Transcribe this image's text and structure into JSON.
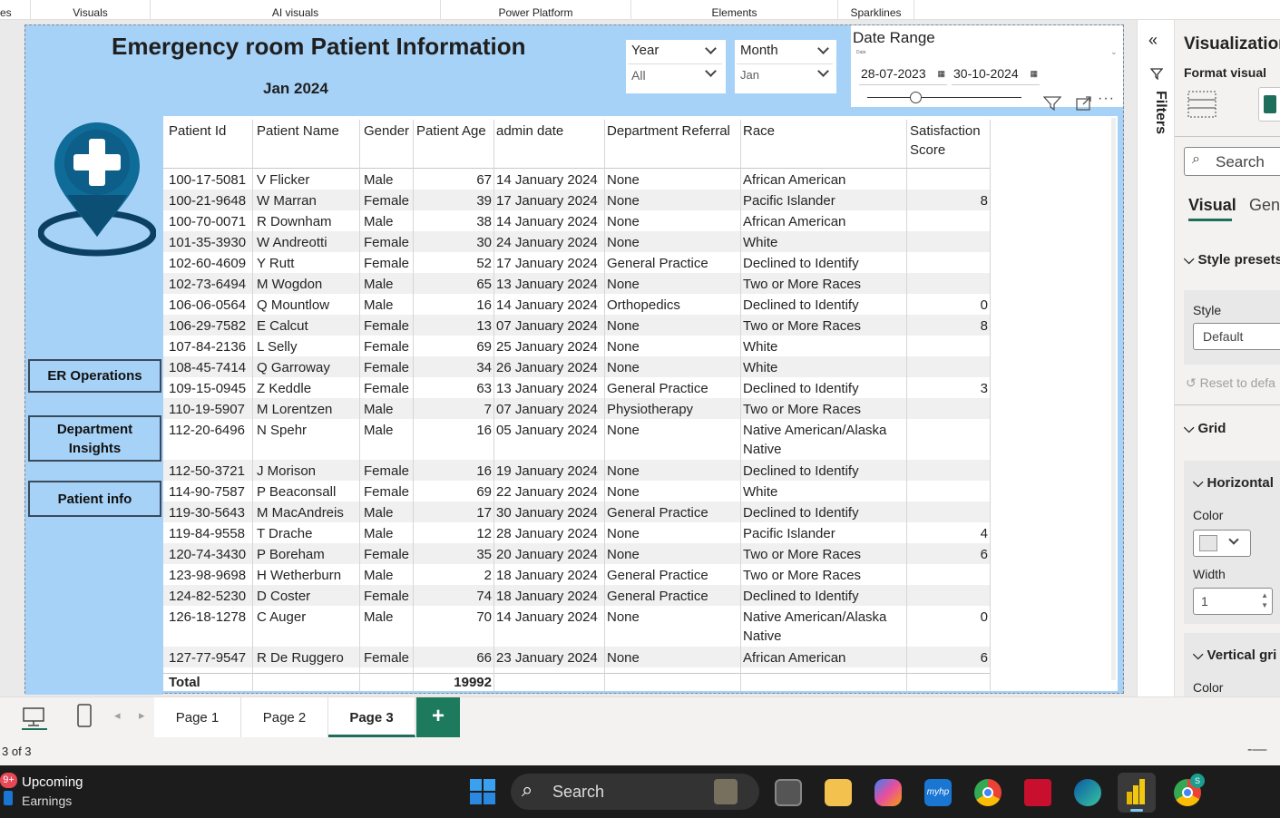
{
  "ribbon": {
    "groups": [
      "es",
      "Visuals",
      "AI visuals",
      "Power Platform",
      "Elements",
      "Sparklines"
    ]
  },
  "report": {
    "title": "Emergency room Patient Information",
    "subtitle": "Jan 2024",
    "year_slicer": {
      "label": "Year",
      "value": "All"
    },
    "month_slicer": {
      "label": "Month",
      "value": "Jan"
    },
    "date_range": {
      "label": "Date Range",
      "small_label": "Date",
      "start": "28-07-2023",
      "end": "30-10-2024"
    },
    "nav_buttons": [
      "ER Operations",
      "Department Insights",
      "Patient info"
    ],
    "table": {
      "headers": [
        "Patient Id",
        "Patient Name",
        "Gender",
        "Patient Age",
        "admin date",
        "Department Referral",
        "Race",
        "Satisfaction Score"
      ],
      "rows": [
        [
          "100-17-5081",
          "V Flicker",
          "Male",
          "67",
          "14 January 2024",
          "None",
          "African American",
          ""
        ],
        [
          "100-21-9648",
          "W Marran",
          "Female",
          "39",
          "17 January 2024",
          "None",
          "Pacific Islander",
          "8"
        ],
        [
          "100-70-0071",
          "R Downham",
          "Male",
          "38",
          "14 January 2024",
          "None",
          "African American",
          ""
        ],
        [
          "101-35-3930",
          "W Andreotti",
          "Female",
          "30",
          "24 January 2024",
          "None",
          "White",
          ""
        ],
        [
          "102-60-4609",
          "Y Rutt",
          "Female",
          "52",
          "17 January 2024",
          "General Practice",
          "Declined to Identify",
          ""
        ],
        [
          "102-73-6494",
          "M Wogdon",
          "Male",
          "65",
          "13 January 2024",
          "None",
          "Two or More Races",
          ""
        ],
        [
          "106-06-0564",
          "Q Mountlow",
          "Male",
          "16",
          "14 January 2024",
          "Orthopedics",
          "Declined to Identify",
          "0"
        ],
        [
          "106-29-7582",
          "E Calcut",
          "Female",
          "13",
          "07 January 2024",
          "None",
          "Two or More Races",
          "8"
        ],
        [
          "107-84-2136",
          "L Selly",
          "Female",
          "69",
          "25 January 2024",
          "None",
          "White",
          ""
        ],
        [
          "108-45-7414",
          "Q Garroway",
          "Female",
          "34",
          "26 January 2024",
          "None",
          "White",
          ""
        ],
        [
          "109-15-0945",
          "Z Keddle",
          "Female",
          "63",
          "13 January 2024",
          "General Practice",
          "Declined to Identify",
          "3"
        ],
        [
          "110-19-5907",
          "M Lorentzen",
          "Male",
          "7",
          "07 January 2024",
          "Physiotherapy",
          "Two or More Races",
          ""
        ],
        [
          "112-20-6496",
          "N Spehr",
          "Male",
          "16",
          "05 January 2024",
          "None",
          "Native American/Alaska Native",
          ""
        ],
        [
          "112-50-3721",
          "J Morison",
          "Female",
          "16",
          "19 January 2024",
          "None",
          "Declined to Identify",
          ""
        ],
        [
          "114-90-7587",
          "P Beaconsall",
          "Female",
          "69",
          "22 January 2024",
          "None",
          "White",
          ""
        ],
        [
          "119-30-5643",
          "M MacAndreis",
          "Male",
          "17",
          "30 January 2024",
          "General Practice",
          "Declined to Identify",
          ""
        ],
        [
          "119-84-9558",
          "T Drache",
          "Male",
          "12",
          "28 January 2024",
          "None",
          "Pacific Islander",
          "4"
        ],
        [
          "120-74-3430",
          "P Boreham",
          "Female",
          "35",
          "20 January 2024",
          "None",
          "Two or More Races",
          "6"
        ],
        [
          "123-98-9698",
          "H Wetherburn",
          "Male",
          "2",
          "18 January 2024",
          "General Practice",
          "Two or More Races",
          ""
        ],
        [
          "124-82-5230",
          "D Coster",
          "Female",
          "74",
          "18 January 2024",
          "General Practice",
          "Declined to Identify",
          ""
        ],
        [
          "126-18-1278",
          "C Auger",
          "Male",
          "70",
          "14 January 2024",
          "None",
          "Native American/Alaska Native",
          "0"
        ],
        [
          "127-77-9547",
          "R De Ruggero",
          "Female",
          "66",
          "23 January 2024",
          "None",
          "African American",
          "6"
        ]
      ],
      "total_label": "Total",
      "total_age": "19992"
    }
  },
  "filters_label": "Filters",
  "viz_panel": {
    "title": "Visualization",
    "format_visual": "Format visual",
    "search_placeholder": "Search",
    "tab_visual": "Visual",
    "tab_general": "Gene",
    "style_presets": "Style presets",
    "style_label": "Style",
    "style_value": "Default",
    "reset": "Reset to defa",
    "grid": "Grid",
    "horizontal": "Horizontal",
    "color_label": "Color",
    "width_label": "Width",
    "width_value": "1",
    "vertical": "Vertical gri",
    "color_label2": "Color",
    "h_color": "#e6e6e6",
    "v_color": "#555555"
  },
  "pages": {
    "tabs": [
      "Page 1",
      "Page 2",
      "Page 3"
    ],
    "active": "Page 3",
    "add": "+"
  },
  "status": {
    "page_of": "3 of 3"
  },
  "taskbar": {
    "badge": "9+",
    "news_title": "Upcoming",
    "news_sub": "Earnings",
    "search": "Search"
  }
}
